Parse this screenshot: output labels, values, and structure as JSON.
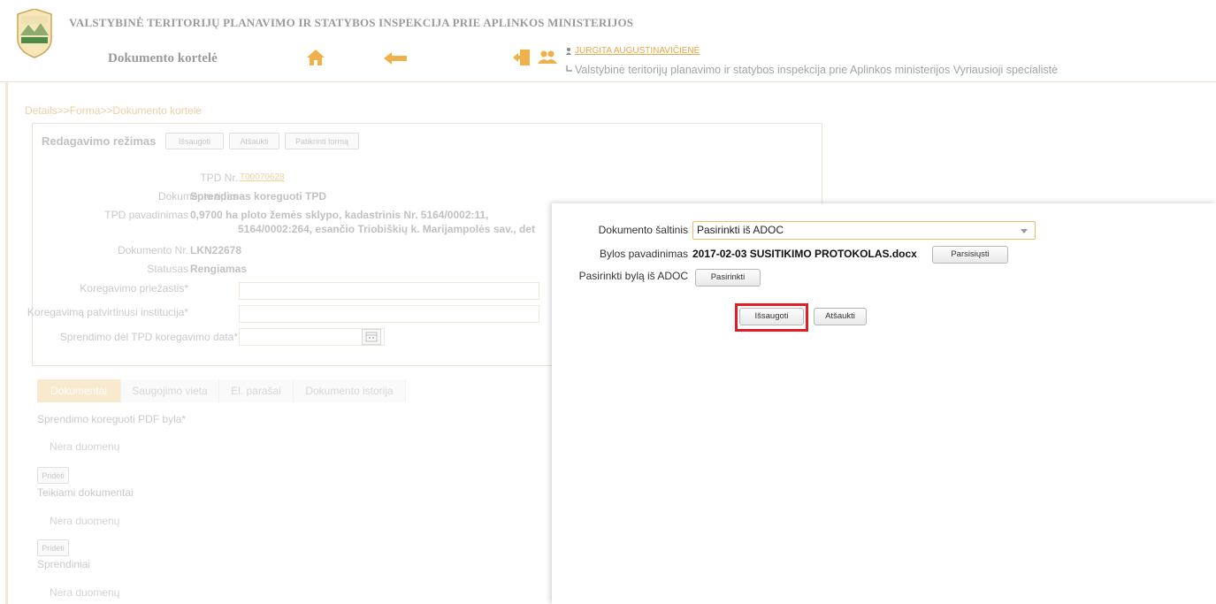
{
  "header": {
    "org_title": "VALSTYBINĖ TERITORIJŲ PLANAVIMO IR STATYBOS INSPEKCIJA PRIE APLINKOS MINISTERIJOS",
    "page_title": "Dokumento kortelė",
    "user_name": "JURGITA AUGUSTINAVIČIENĖ",
    "user_role": "Valstybinė teritorijų planavimo ir statybos inspekcija prie Aplinkos ministerijos Vyriausioji specialistė",
    "logo_text": "VALSTYBINĖ TERITORIJŲ PLANAVIMO IR STATYBOS INSPEKCIJA",
    "icons": [
      "home-icon",
      "back-arrow-icon",
      "logout-icon",
      "users-icon"
    ]
  },
  "breadcrumb": "Details>>Forma>>Dokumento kortelė",
  "edit_panel": {
    "mode_label": "Redagavimo režimas",
    "buttons": {
      "save": "Išsaugoti",
      "cancel": "Atšaukti",
      "validate": "Patikrinti formą"
    },
    "fields": {
      "tpd_nr_label": "TPD Nr.",
      "tpd_nr_value": "T00070628",
      "doc_type_label": "Dokumento tipas",
      "doc_type_value": "Sprendimas koreguoti TPD",
      "tpd_name_label": "TPD pavadinimas",
      "tpd_name_line1": "0,9700 ha ploto žemės sklypo, kadastrinis Nr. 5164/0002:11,",
      "tpd_name_line2": "5164/0002:264, esančio Triobiškių k. Marijampolės sav., det",
      "doc_nr_label": "Dokumento Nr.",
      "doc_nr_value": "LKN22678",
      "status_label": "Statusas",
      "status_value": "Rengiamas",
      "reason_label": "Koregavimo priežastis*",
      "institution_label": "Koregavimą patvirtinusi institucija*",
      "date_label": "Sprendimo dėl TPD koregavimo data*"
    }
  },
  "tabs": [
    {
      "label": "Dokumentai",
      "active": true
    },
    {
      "label": "Saugojimo vieta",
      "active": false
    },
    {
      "label": "El. parašai",
      "active": false
    },
    {
      "label": "Dokumento istorija",
      "active": false
    }
  ],
  "sections": [
    {
      "title": "Sprendimo koreguoti PDF byla*",
      "empty_text": "Nėra duomenų",
      "add_label": "Pridėti"
    },
    {
      "title": "Teikiami dokumentai",
      "empty_text": "Nėra duomenų",
      "add_label": "Pridėti"
    },
    {
      "title": "Sprendiniai",
      "empty_text": "Nėra duomenų"
    }
  ],
  "dialog": {
    "source_label": "Dokumento šaltinis",
    "source_value": "Pasirinkti iš ADOC",
    "file_label": "Bylos pavadinimas",
    "file_value": "2017-02-03 SUSITIKIMO PROTOKOLAS.docx",
    "download_label": "Parsisiųsti",
    "choose_label": "Pasirinkti bylą iš ADOC",
    "choose_button": "Pasirinkti",
    "save_button": "Išsaugoti",
    "cancel_button": "Atšaukti",
    "highlight_color": "#e11d27"
  },
  "colors": {
    "accent": "#e3a94a",
    "tab_active": "#f4d7a4"
  }
}
